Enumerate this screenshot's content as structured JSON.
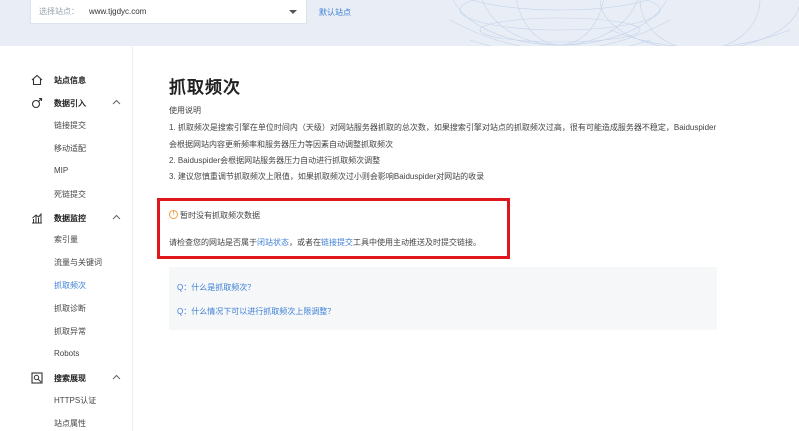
{
  "header": {
    "site_select_label": "选择站点：",
    "site_select_value": "www.tjgdyc.com",
    "default_site": "默认站点"
  },
  "sidebar": {
    "groups": [
      {
        "label": "站点信息",
        "icon": "home-icon"
      },
      {
        "label": "数据引入",
        "icon": "data-import-icon",
        "items": [
          "链接提交",
          "移动适配",
          "MIP",
          "死链提交"
        ]
      },
      {
        "label": "数据监控",
        "icon": "chart-icon",
        "items": [
          "索引量",
          "流量与关键词",
          "抓取频次",
          "抓取诊断",
          "抓取异常",
          "Robots"
        ]
      },
      {
        "label": "搜索展现",
        "icon": "search-display-icon",
        "items": [
          "HTTPS认证",
          "站点属性"
        ]
      }
    ],
    "active_item": "抓取频次"
  },
  "main": {
    "title": "抓取频次",
    "usage_title": "使用说明",
    "usage_lines": [
      "1. 抓取频次是搜索引擎在单位时间内（天级）对网站服务器抓取的总次数，如果搜索引擎对站点的抓取频次过高，很有可能造成服务器不稳定，Baiduspider",
      "会根据网站内容更新频率和服务器压力等因素自动调整抓取频次",
      "2. Baiduspider会根据网站服务器压力自动进行抓取频次调整",
      "3. 建议您慎重调节抓取频次上限值，如果抓取频次过小则会影响Baiduspider对网站的收录"
    ],
    "alert": {
      "title": "暂时没有抓取频次数据",
      "desc_prefix": "请检查您的网站是否属于",
      "link1": "闭站状态",
      "desc_middle": "，或者在",
      "link2": "链接提交",
      "desc_suffix": "工具中使用主动推送及时提交链接。"
    },
    "faq": [
      "Q：什么是抓取频次？",
      "Q：什么情况下可以进行抓取频次上限调整？"
    ]
  }
}
